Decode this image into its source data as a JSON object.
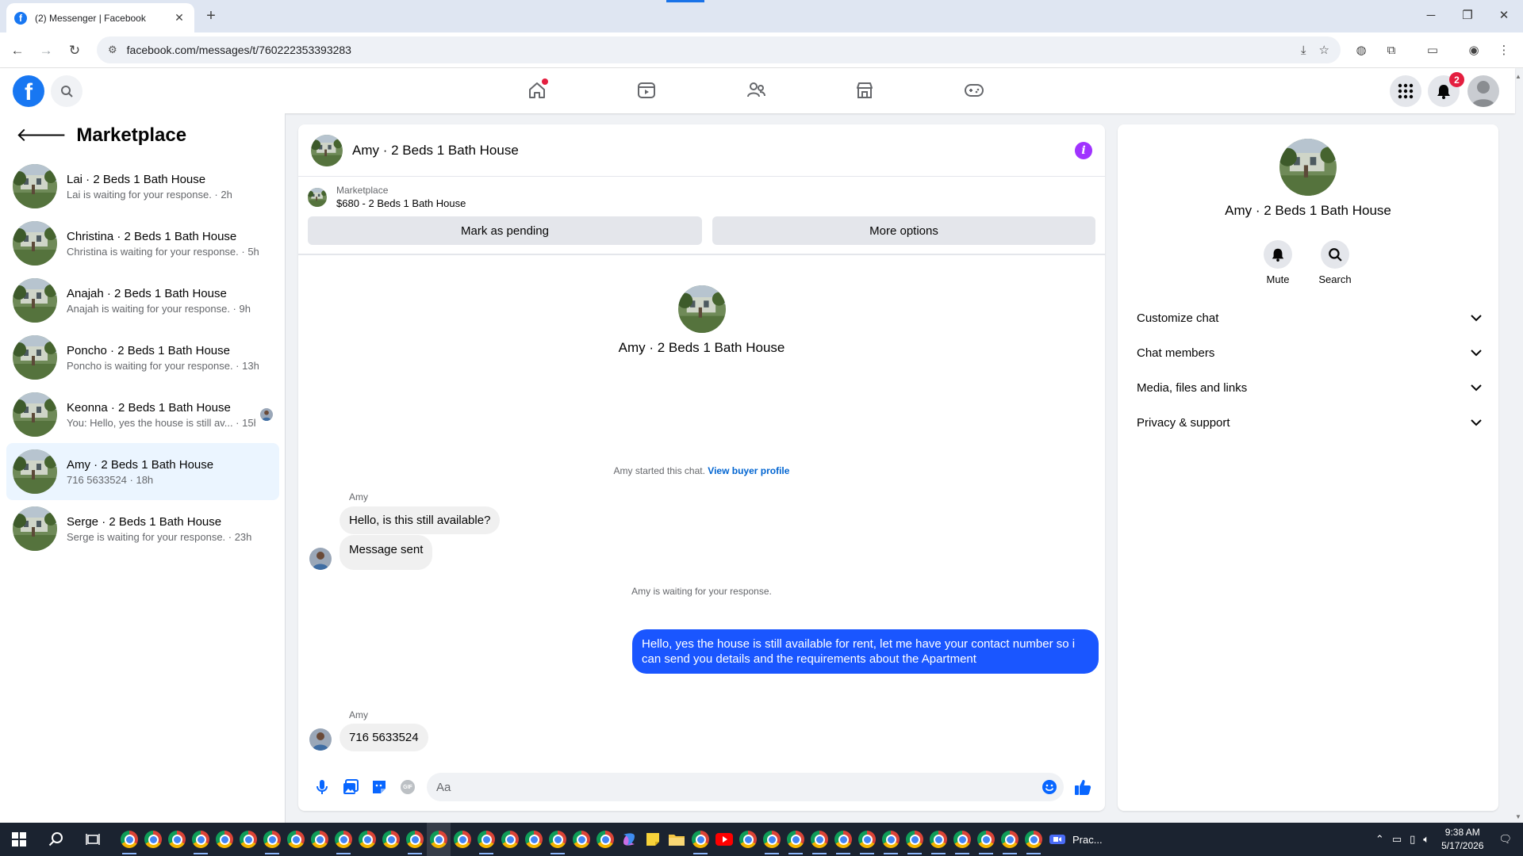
{
  "browser": {
    "tab_title": "(2) Messenger | Facebook",
    "url": "facebook.com/messages/t/760222353393283"
  },
  "header": {
    "notification_count": "2"
  },
  "sidebar": {
    "title": "Marketplace",
    "conversations": [
      {
        "name": "Lai · 2 Beds 1 Bath House",
        "preview": "Lai is waiting for your response. · 2h"
      },
      {
        "name": "Christina · 2 Beds 1 Bath House",
        "preview": "Christina is waiting for your response. · 5h"
      },
      {
        "name": "Anajah · 2 Beds 1 Bath House",
        "preview": "Anajah is waiting for your response. · 9h"
      },
      {
        "name": "Poncho · 2 Beds 1 Bath House",
        "preview": "Poncho is waiting for your response. · 13h"
      },
      {
        "name": "Keonna · 2 Beds 1 Bath House",
        "preview": "You: Hello, yes the house is still av... · 15h"
      },
      {
        "name": "Amy · 2 Beds 1 Bath House",
        "preview": "716 5633524 · 18h"
      },
      {
        "name": "Serge · 2 Beds 1 Bath House",
        "preview": "Serge is waiting for your response. · 23h"
      }
    ]
  },
  "chat": {
    "title": "Amy · 2 Beds 1 Bath House",
    "listing_label": "Marketplace",
    "listing_title": "$680 - 2 Beds 1 Bath House",
    "mark_pending_label": "Mark as pending",
    "more_options_label": "More options",
    "intro_name": "Amy · 2 Beds 1 Bath House",
    "started_text": "Amy started this chat.",
    "view_profile_label": "View buyer profile",
    "sender_name": "Amy",
    "msg_1": "Hello, is this still available?",
    "msg_2": "Message sent",
    "waiting_text": "Amy is waiting for your response.",
    "msg_out": "Hello, yes the house is still available for rent, let me have your contact number so i can send you details and the requirements about the    Apartment",
    "msg_3": "716 5633524",
    "composer_placeholder": "Aa",
    "gif_label": "GIF"
  },
  "right_panel": {
    "name": "Amy · 2 Beds 1 Bath House",
    "mute_label": "Mute",
    "search_label": "Search",
    "sections": [
      "Customize chat",
      "Chat members",
      "Media, files and links",
      "Privacy & support"
    ]
  },
  "taskbar": {
    "app_label": "Prac...",
    "time": "9:38 AM",
    "date": "5/17/2026"
  },
  "colors": {
    "fb_blue": "#1877f2",
    "outgoing_bubble": "#1a56ff",
    "info_purple": "#a033ff",
    "badge_red": "#e41e3f"
  },
  "icons": [
    "facebook-logo-icon",
    "search-icon",
    "home-icon",
    "video-icon",
    "friends-icon",
    "marketplace-icon",
    "gaming-icon",
    "menu-grid-icon",
    "bell-icon",
    "info-icon",
    "microphone-icon",
    "photo-icon",
    "sticker-icon",
    "gif-icon",
    "emoji-icon",
    "like-icon",
    "chevron-down-icon"
  ]
}
